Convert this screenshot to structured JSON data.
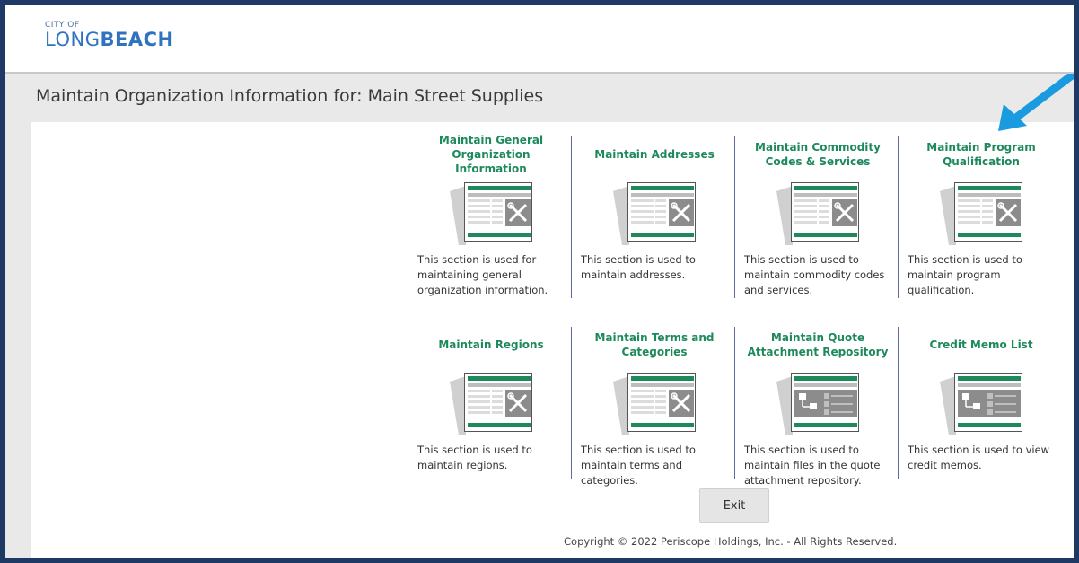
{
  "logo": {
    "city": "CITY OF",
    "name_light": "LONG",
    "name_bold": "BEACH"
  },
  "page_title": "Maintain Organization Information for: Main Street Supplies",
  "tiles": [
    {
      "heading": "Maintain General Organization Information",
      "icon": "tools-icon",
      "desc": "This section is used for maintaining general organization information."
    },
    {
      "heading": "Maintain Addresses",
      "icon": "tools-icon",
      "desc": "This section is used to maintain addresses."
    },
    {
      "heading": "Maintain Commodity Codes & Services",
      "icon": "tools-icon",
      "desc": "This section is used to maintain commodity codes and services."
    },
    {
      "heading": "Maintain Program Qualification",
      "icon": "tools-icon",
      "desc": "This section is used to maintain program qualification."
    },
    {
      "heading": "Maintain Regions",
      "icon": "tools-icon",
      "desc": "This section is used to maintain regions."
    },
    {
      "heading": "Maintain Terms and Categories",
      "icon": "tools-icon",
      "desc": "This section is used to maintain terms and categories."
    },
    {
      "heading": "Maintain Quote Attachment Repository",
      "icon": "hierarchy-icon",
      "desc": "This section is used to maintain files in the quote attachment repository."
    },
    {
      "heading": "Credit Memo List",
      "icon": "hierarchy-icon",
      "desc": "This section is used to view credit memos."
    }
  ],
  "exit_label": "Exit",
  "copyright": "Copyright © 2022 Periscope Holdings, Inc. - All Rights Reserved.",
  "colors": {
    "heading": "#1e8a5c",
    "accent_green": "#1e8a5c",
    "frame": "#1e3a64",
    "arrow": "#1a9be0"
  }
}
